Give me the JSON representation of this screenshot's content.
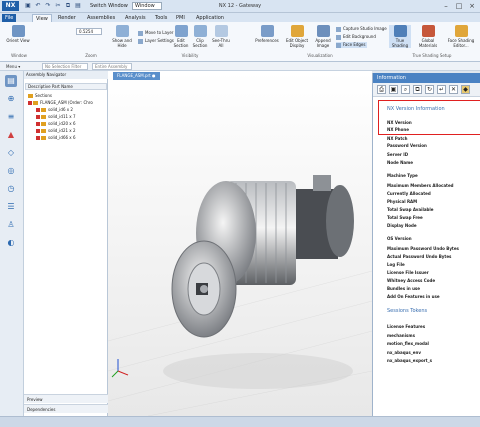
{
  "title_bar": {
    "logo": "NX",
    "switch_window": "Switch Window",
    "window": "Window",
    "title": "NX 12 - Gateway",
    "minimize": "–",
    "maximize": "□",
    "close": "×"
  },
  "tabs": [
    "File",
    "View",
    "Render",
    "Assemblies",
    "Analysis",
    "Tools",
    "PMI",
    "Application"
  ],
  "ribbon": {
    "orient": "Orient View",
    "zoom_value": "0.5254",
    "zoom_group": "Zoom",
    "window_group": "Window",
    "move_to_layer": "Move to Layer",
    "layer_settings": "Layer Settings",
    "show_and_hide": "Show and Hide",
    "edit_section": "Edit Section",
    "clip_section": "Clip Section",
    "see_thru_all": "See-Thru All",
    "visibility_group": "Visibility",
    "preferences": "Preferences",
    "edit_object_display": "Edit Object Display",
    "append_image": "Append Image",
    "capture_studio_image": "Capture Studio Image",
    "edit_background": "Edit Background",
    "face_edges": "Face Edges",
    "visualization_group": "Visualization",
    "true_shading": "True Shading",
    "global_materials": "Global Materials",
    "face_shading_editor": "Face Shading Editor...",
    "true_shading_group": "True Shading Setup"
  },
  "cmdbar": {
    "menu": "Menu ▾",
    "filter": "No Selection Filter",
    "assembly": "Entire Assembly"
  },
  "nav": {
    "title": "Assembly Navigator",
    "column": "Descriptive Part Name",
    "items": [
      "Sections",
      "FLANGE_ASM (Order: Chro",
      "solid_id6 x 2",
      "solid_id11 x 7",
      "solid_id20 x 6",
      "solid_id21 x 2",
      "solid_id66 x 6"
    ],
    "preview": "Preview",
    "dependencies": "Dependencies"
  },
  "viewport": {
    "tab": "FLANGE_ASM.prt ●"
  },
  "info": {
    "title": "Information",
    "section1": "NX Version Information",
    "rows1": [
      "NX Version",
      "NX Phone",
      "NX Patch",
      "Password Version",
      "Server ID",
      "Node Name",
      "Machine Type",
      "Maximum Members Allocated",
      "Currently Allocated",
      "Physical RAM",
      "Total Swap Available",
      "Total Swap Free",
      "Display Node",
      "OS Version",
      "Maximum Password Undo Bytes",
      "Actual Password Undo Bytes",
      "Log File",
      "License File Issuer",
      "Whitney Access Code",
      "Bundles in use",
      "Add On Features in use"
    ],
    "section2": "Sessions Tokens",
    "rows2": [
      "License Features",
      "mechanisms",
      "motion_flex_modal",
      "nx_abaqus_env",
      "nx_abaqus_export_s"
    ]
  }
}
